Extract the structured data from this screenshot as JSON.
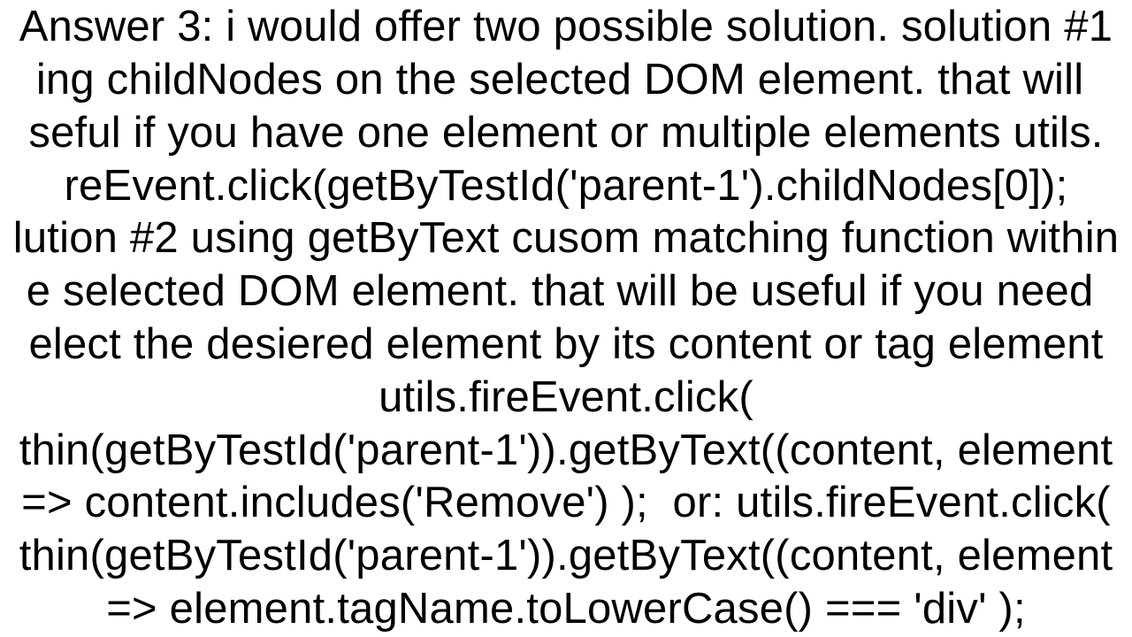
{
  "answer": {
    "lines": [
      "Answer 3: i would offer two possible solution. solution #1",
      "ing childNodes on the selected DOM element. that will ",
      "seful if you have one element or multiple elements utils.",
      "reEvent.click(getByTestId('parent-1').childNodes[0]);",
      "lution #2 using getByText cusom matching function within",
      "e selected DOM element. that will be useful if you need ",
      "elect the desiered element by its content or tag element",
      "utils.fireEvent.click(",
      "thin(getByTestId('parent-1')).getByText((content, element",
      "=> content.includes('Remove') );  or: utils.fireEvent.click(",
      "thin(getByTestId('parent-1')).getByText((content, element",
      "=> element.tagName.toLowerCase() === 'div' );"
    ]
  }
}
